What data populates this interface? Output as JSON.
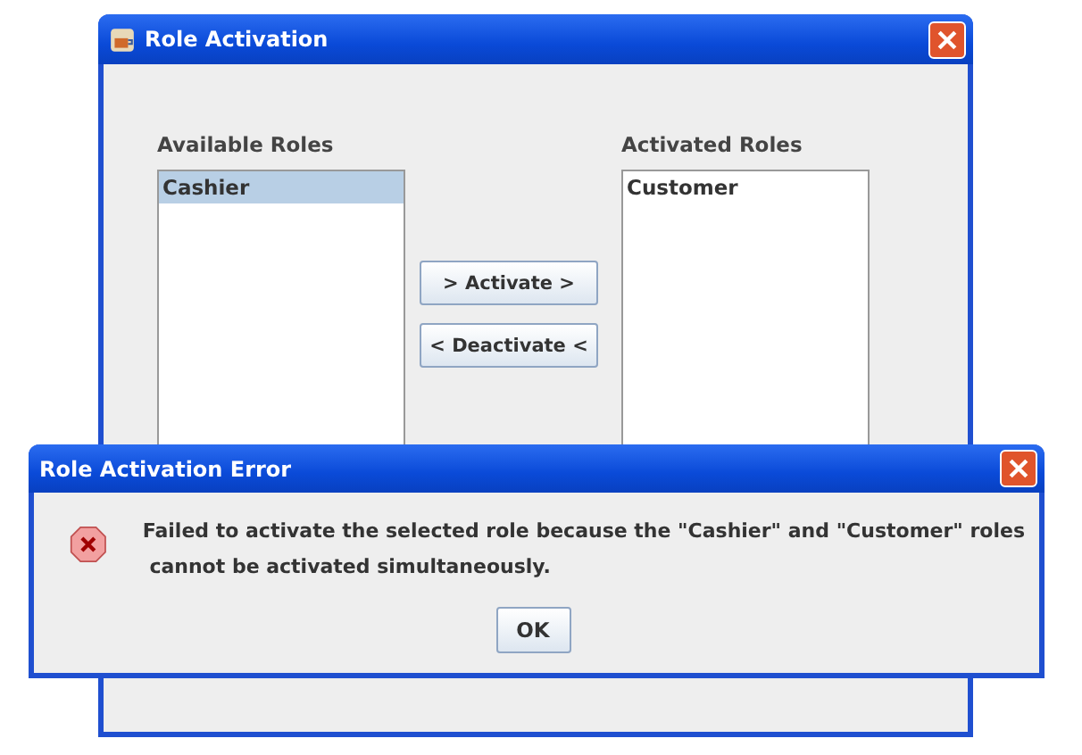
{
  "window": {
    "title": "Role Activation"
  },
  "available_roles": {
    "label": "Available Roles",
    "items": [
      {
        "name": "Cashier",
        "selected": true
      }
    ]
  },
  "activated_roles": {
    "label": "Activated Roles",
    "items": [
      {
        "name": "Customer",
        "selected": false
      }
    ]
  },
  "buttons": [
    "> Activate >",
    "< Deactivate <"
  ],
  "error_dialog": {
    "title": "Role Activation Error",
    "message_lines": [
      "Failed to activate the selected role because the \"Cashier\" and \"Customer\" roles",
      " cannot be activated simultaneously."
    ],
    "button": "OK"
  }
}
